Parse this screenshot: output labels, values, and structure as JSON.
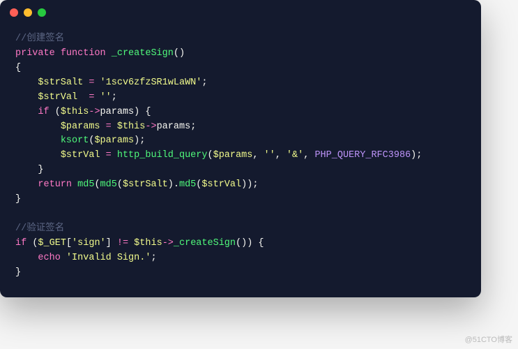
{
  "watermark": "@51CTO博客",
  "code": {
    "comment1": "//创建签名",
    "line_private": "private",
    "line_function": "function",
    "fn_name": "_createSign",
    "var_strSalt": "$strSalt",
    "val_strSalt": "'1scv6zfzSR1wLaWN'",
    "var_strVal": "$strVal",
    "val_empty": "''",
    "kw_if": "if",
    "var_this": "$this",
    "prop_params": "params",
    "var_params": "$params",
    "fn_ksort": "ksort",
    "fn_http_build_query": "http_build_query",
    "str_amp": "'&'",
    "const_rfc": "PHP_QUERY_RFC3986",
    "kw_return": "return",
    "fn_md5": "md5",
    "comment2": "//验证签名",
    "var_get": "$_GET",
    "key_sign": "'sign'",
    "op_neq": "!=",
    "fn_createSign": "_createSign",
    "kw_echo": "echo",
    "str_invalid": "'Invalid Sign.'"
  }
}
